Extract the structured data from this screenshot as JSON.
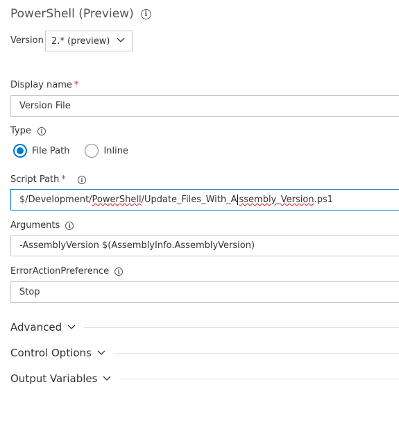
{
  "task": {
    "title": "PowerShell (Preview)",
    "version_label": "Version",
    "version_value": "2.* (preview)"
  },
  "fields": {
    "display_name": {
      "label": "Display name",
      "required": "*",
      "value": "Version File"
    },
    "type": {
      "label": "Type",
      "options": [
        "File Path",
        "Inline"
      ],
      "selected": "File Path"
    },
    "script_path": {
      "label": "Script Path",
      "required": "*",
      "value_parts": [
        "$/Development/",
        "PowerShell",
        "/Update_Files_With_A",
        "ssembly",
        "_",
        "Version",
        ".ps1"
      ]
    },
    "arguments": {
      "label": "Arguments",
      "value": "-AssemblyVersion $(AssemblyInfo.AssemblyVersion)"
    },
    "error_action": {
      "label": "ErrorActionPreference",
      "value": "Stop"
    }
  },
  "sections": {
    "advanced": "Advanced",
    "control_options": "Control Options",
    "output_variables": "Output Variables"
  },
  "colors": {
    "accent": "#0078d4",
    "required": "#c4314b",
    "spellcheck": "#e81123"
  },
  "icons": {
    "info": "info-icon",
    "chevron": "chevron-down-icon"
  }
}
